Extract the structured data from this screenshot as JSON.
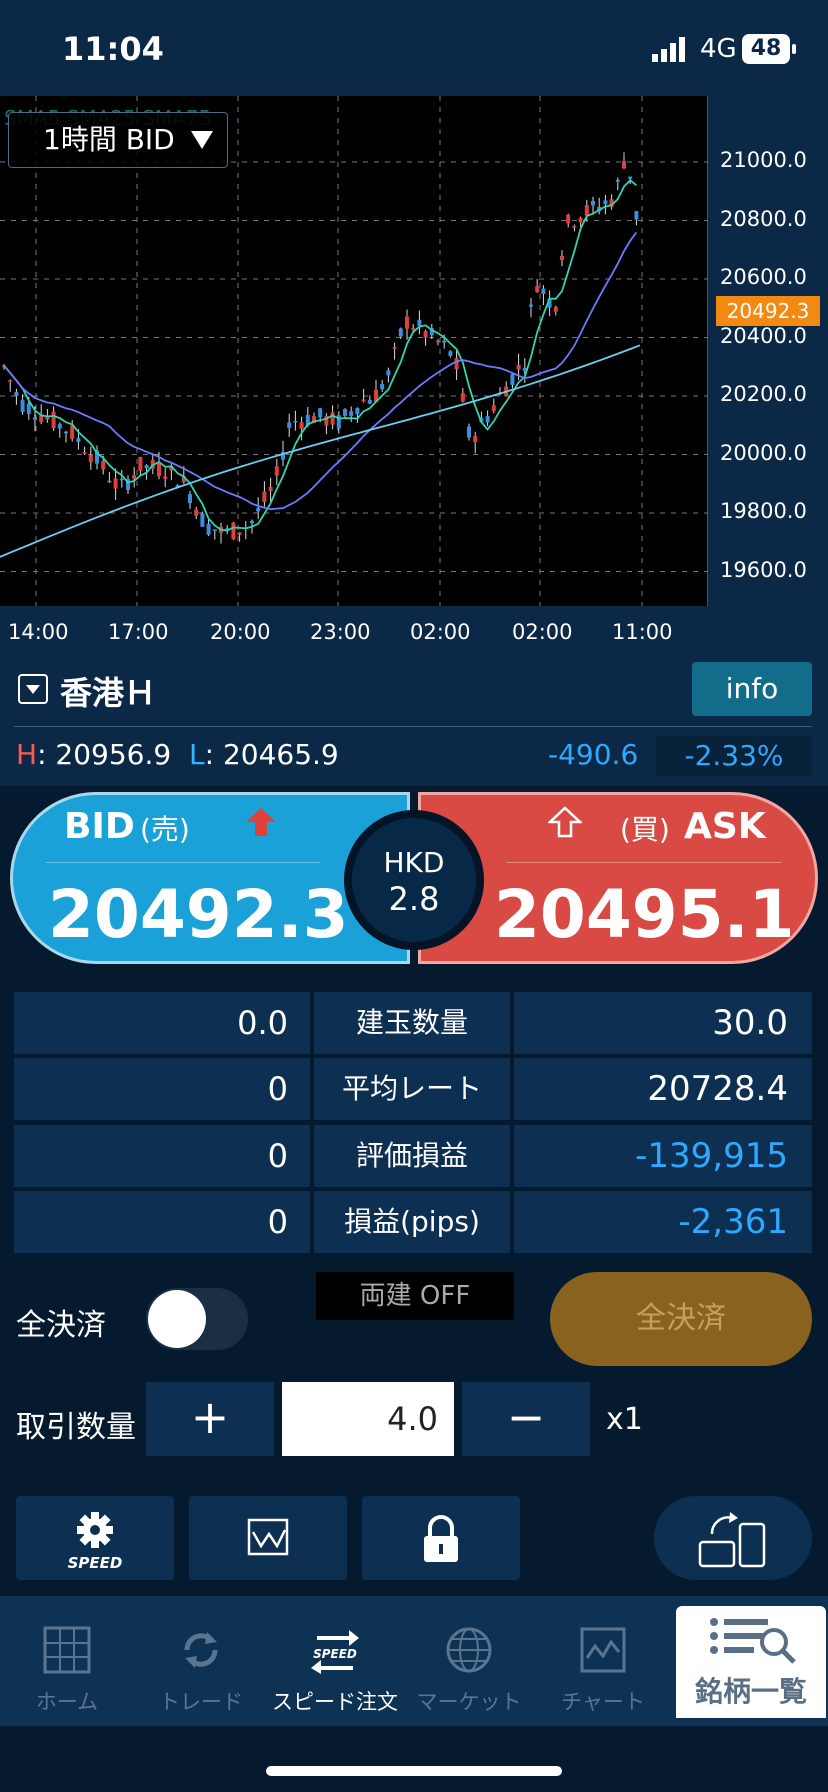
{
  "status_bar": {
    "time": "11:04",
    "network": "4G",
    "battery": "48"
  },
  "chart": {
    "timeframe_label": "1時間 BID",
    "sma_label": "SMA5 SMA25 SMA75",
    "y_ticks": [
      "21000.0",
      "20800.0",
      "20600.0",
      "20400.0",
      "20200.0",
      "20000.0",
      "19800.0",
      "19600.0"
    ],
    "x_ticks": [
      "14:00",
      "17:00",
      "20:00",
      "23:00",
      "02:00",
      "02:00",
      "11:00"
    ],
    "current_price_tag": "20492.3",
    "up_color": "#e0403a",
    "down_color": "#3a8fe0",
    "sma_short_color": "#2fd6b0",
    "sma_mid_color": "#6a7cff",
    "sma_long_color": "#6ad0f0"
  },
  "symbol": {
    "name": "香港Ｈ",
    "info_label": "info",
    "high_label": "H",
    "high_value": ": 20956.9",
    "low_label": "L",
    "low_value": ": 20465.9",
    "change": "-490.6",
    "change_pct": "-2.33%"
  },
  "quote": {
    "bid_label": "BID",
    "bid_sub": "(売)",
    "bid_price": "20492.3",
    "ask_label": "ASK",
    "ask_sub": "(買)",
    "ask_price": "20495.1",
    "spread_currency": "HKD",
    "spread_value": "2.8"
  },
  "positions": [
    {
      "left": "0.0",
      "label": "建玉数量",
      "right": "30.0"
    },
    {
      "left": "0",
      "label": "平均レート",
      "right": "20728.4"
    },
    {
      "left": "0",
      "label": "評価損益",
      "right": "-139,915"
    },
    {
      "left": "0",
      "label": "損益(pips)",
      "right": "-2,361"
    }
  ],
  "controls": {
    "close_all_toggle_label": "全決済",
    "hedge_label": "両建 OFF",
    "close_all_button": "全決済",
    "qty_label": "取引数量",
    "plus": "+",
    "minus": "−",
    "qty_value": "4.0",
    "multiplier": "x1",
    "speed_settings_label": "SPEED"
  },
  "tabs": [
    {
      "label": "ホーム"
    },
    {
      "label": "トレード"
    },
    {
      "label": "スピード注文"
    },
    {
      "label": "マーケット"
    },
    {
      "label": "チャート"
    },
    {
      "label": "銘柄一覧"
    }
  ]
}
